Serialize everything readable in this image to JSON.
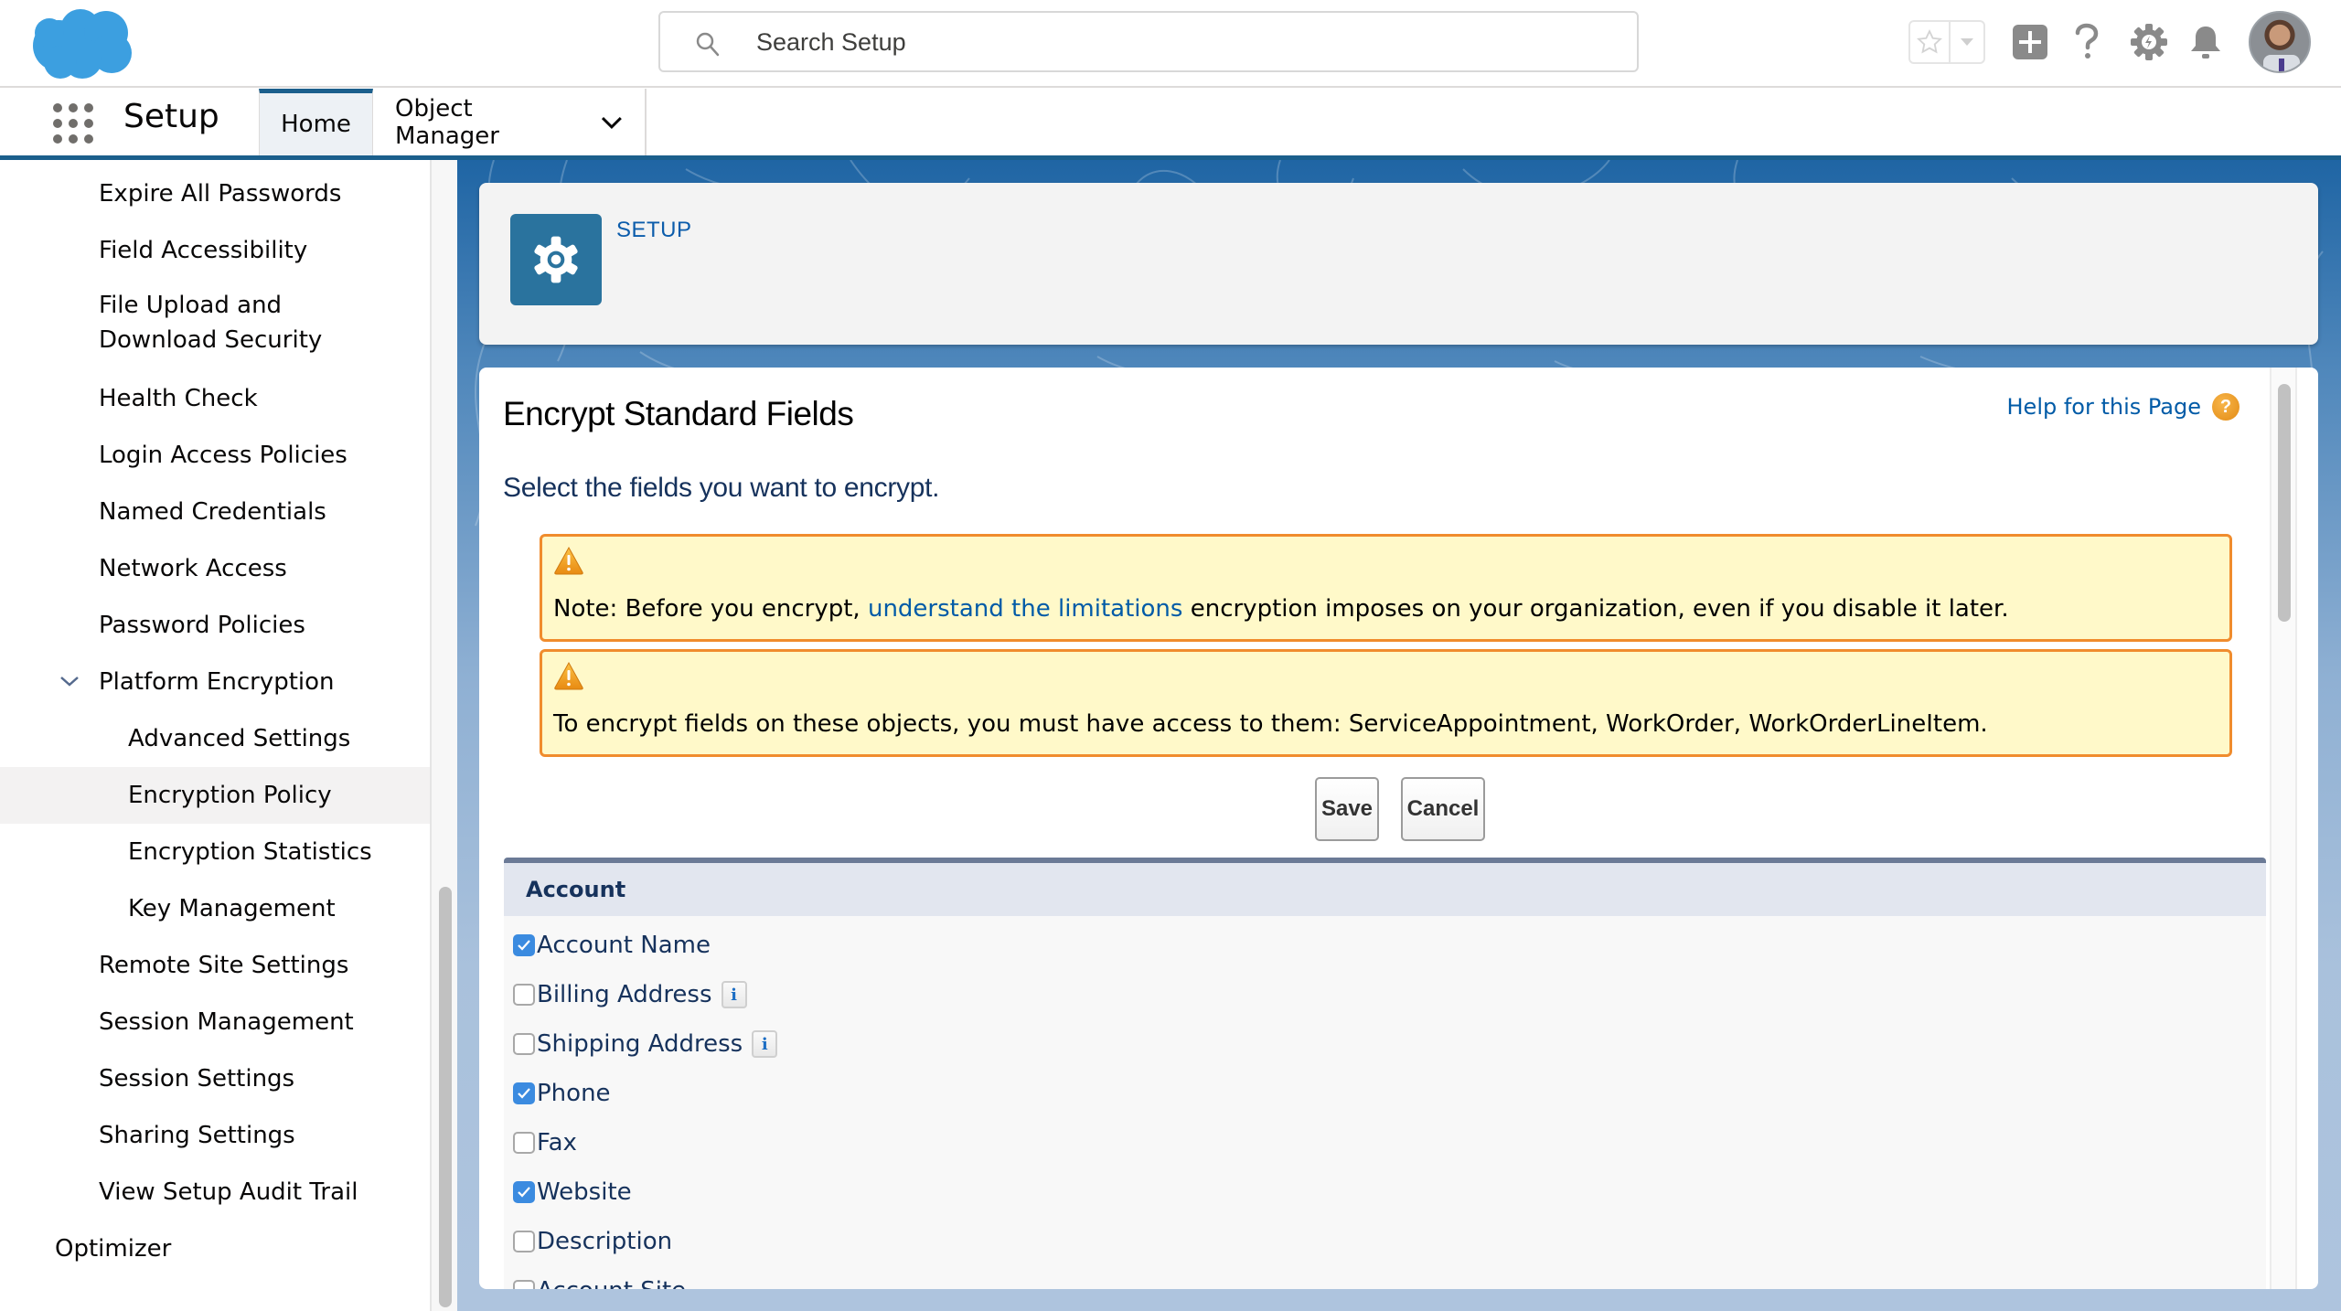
{
  "header": {
    "search": {
      "placeholder": "Search Setup",
      "value": ""
    },
    "icons": [
      "favorites-star-icon",
      "favorites-dropdown-icon",
      "global-add-icon",
      "help-icon",
      "setup-gear-icon",
      "notifications-bell-icon",
      "user-avatar"
    ]
  },
  "nav": {
    "app_name": "Setup",
    "tabs": [
      {
        "label": "Home",
        "active": true
      },
      {
        "label": "Object Manager",
        "has_dropdown": true
      }
    ]
  },
  "sidebar": {
    "items": [
      {
        "label": "Expire All Passwords",
        "level": 1
      },
      {
        "label": "Field Accessibility",
        "level": 1
      },
      {
        "label": "File Upload and Download Security",
        "level": 1
      },
      {
        "label": "Health Check",
        "level": 1
      },
      {
        "label": "Login Access Policies",
        "level": 1
      },
      {
        "label": "Named Credentials",
        "level": 1
      },
      {
        "label": "Network Access",
        "level": 1
      },
      {
        "label": "Password Policies",
        "level": 1
      },
      {
        "label": "Platform Encryption",
        "level": 1,
        "expanded": true
      },
      {
        "label": "Advanced Settings",
        "level": 2
      },
      {
        "label": "Encryption Policy",
        "level": 2,
        "active": true
      },
      {
        "label": "Encryption Statistics",
        "level": 2
      },
      {
        "label": "Key Management",
        "level": 2
      },
      {
        "label": "Remote Site Settings",
        "level": 1
      },
      {
        "label": "Session Management",
        "level": 1
      },
      {
        "label": "Session Settings",
        "level": 1
      },
      {
        "label": "Sharing Settings",
        "level": 1
      },
      {
        "label": "View Setup Audit Trail",
        "level": 1
      },
      {
        "label": "Optimizer",
        "level": 0
      }
    ]
  },
  "setup_card": {
    "label": "SETUP"
  },
  "content": {
    "title": "Encrypt Standard Fields",
    "help_link": "Help for this Page",
    "subtitle": "Select the fields you want to encrypt.",
    "warnings": [
      {
        "prefix": "Note: Before you encrypt, ",
        "link": "understand the limitations",
        "suffix": " encryption imposes on your organization, even if you disable it later."
      },
      {
        "prefix": "To encrypt fields on these objects, you must have access to them: ServiceAppointment, WorkOrder, WorkOrderLineItem.",
        "link": "",
        "suffix": ""
      }
    ],
    "buttons": {
      "save": "Save",
      "cancel": "Cancel"
    },
    "section": {
      "title": "Account",
      "fields": [
        {
          "label": "Account Name",
          "checked": true,
          "info": false
        },
        {
          "label": "Billing Address",
          "checked": false,
          "info": true
        },
        {
          "label": "Shipping Address",
          "checked": false,
          "info": true
        },
        {
          "label": "Phone",
          "checked": true,
          "info": false
        },
        {
          "label": "Fax",
          "checked": false,
          "info": false
        },
        {
          "label": "Website",
          "checked": true,
          "info": false
        },
        {
          "label": "Description",
          "checked": false,
          "info": false
        },
        {
          "label": "Account Site",
          "checked": false,
          "info": false
        }
      ],
      "info_glyph": "i"
    }
  },
  "colors": {
    "brand_blue": "#1b5f8c",
    "link_blue": "#015ba7",
    "warning_bg": "#fff9c9",
    "warning_border": "#f08c2d",
    "checkbox_checked": "#3b8be0",
    "setup_icon_bg": "#2a739e"
  }
}
